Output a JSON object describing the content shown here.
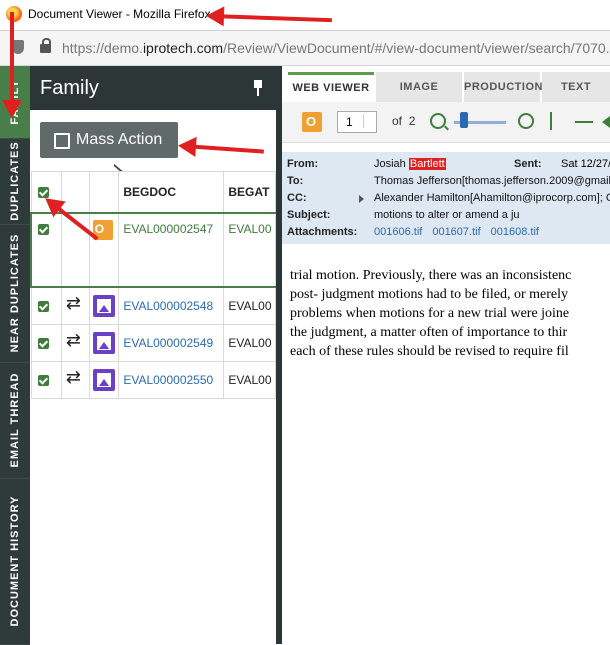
{
  "window": {
    "title": "Document Viewer - Mozilla Firefox"
  },
  "browser": {
    "url_prefix": "https://demo.",
    "url_domain": "iprotech.com",
    "url_rest": "/Review/ViewDocument/#/view-document/viewer/search/7070..."
  },
  "side_tabs": [
    "FAMILY",
    "DUPLICATES",
    "NEAR DUPLICATES",
    "EMAIL THREAD",
    "DOCUMENT HISTORY"
  ],
  "family": {
    "title": "Family",
    "mass_action_label": "Mass Action",
    "columns": [
      "BEGDOC",
      "BEGAT"
    ],
    "rows": [
      {
        "begdoc": "EVAL000002547",
        "begat": "EVAL00",
        "type": "email"
      },
      {
        "begdoc": "EVAL000002548",
        "begat": "EVAL00",
        "type": "image"
      },
      {
        "begdoc": "EVAL000002549",
        "begat": "EVAL00",
        "type": "image"
      },
      {
        "begdoc": "EVAL000002550",
        "begat": "EVAL00",
        "type": "image"
      }
    ]
  },
  "viewer": {
    "tabs": [
      "WEB VIEWER",
      "IMAGE",
      "PRODUCTION",
      "TEXT"
    ],
    "page_current": "1",
    "page_of": "of",
    "page_total": "2",
    "email": {
      "from_label": "From:",
      "from_value_prefix": "Josiah ",
      "from_value_highlight": "Bartlett",
      "sent_label": "Sent:",
      "sent_value": "Sat 12/27/",
      "to_label": "To:",
      "to_value": "Thomas Jefferson[thomas.jefferson.2009@gmail.c",
      "cc_label": "CC:",
      "cc_value": "Alexander Hamilton[Ahamilton@iprocorp.com]; G",
      "subject_label": "Subject:",
      "subject_value": "motions to alter or amend a ju",
      "attachments_label": "Attachments:",
      "attachments": [
        "001606.tif",
        "001607.tif",
        "001608.tif"
      ]
    },
    "body_lines": [
      "trial motion. Previously, there was an inconsistenc",
      "post- judgment motions had to be filed, or merely",
      "problems when motions for a new trial were joine",
      "the judgment, a matter often of importance to thir",
      "each of these rules should be revised to require fil"
    ]
  }
}
